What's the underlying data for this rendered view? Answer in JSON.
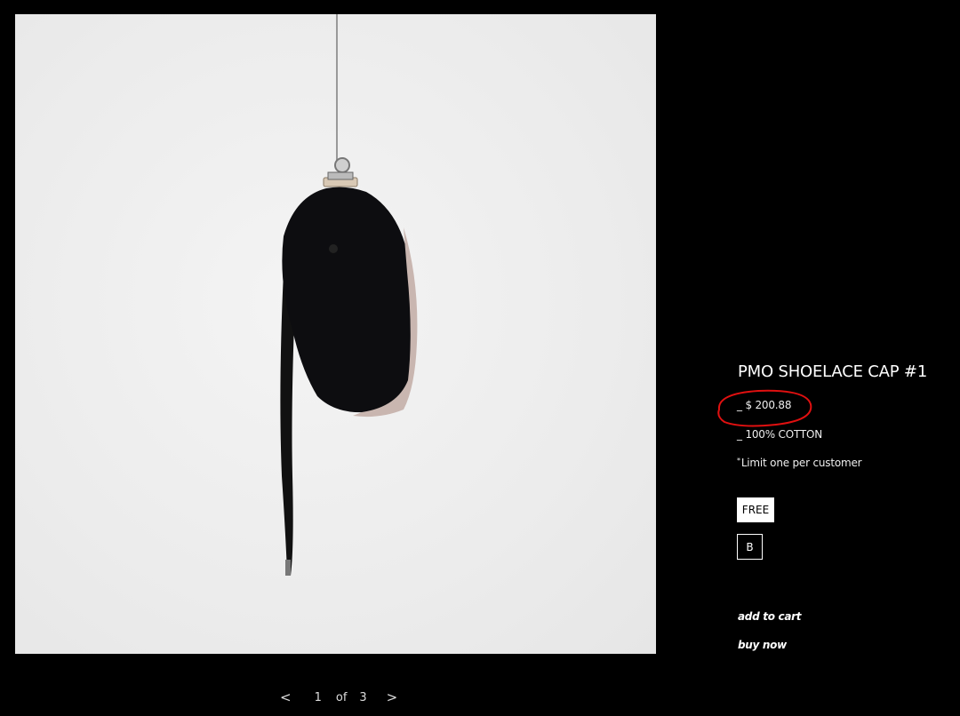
{
  "product": {
    "title": "PMO SHOELACE CAP #1",
    "price_prefix": "_",
    "price": "$ 200.88",
    "material_prefix": "_",
    "material": "100% COTTON",
    "limit_mark": "*",
    "limit": "Limit one per customer"
  },
  "sizes": [
    {
      "label": "FREE",
      "selected": true
    },
    {
      "label": "B",
      "selected": false
    }
  ],
  "actions": {
    "add_to_cart": "add to cart",
    "buy_now": "buy now"
  },
  "pager": {
    "prev": "<",
    "current": "1",
    "of": "of",
    "total": "3",
    "next": ">"
  },
  "image": {
    "subject": "black baseball cap hanging from a clip with a long shoelace strap",
    "annotation_color": "#e01010"
  }
}
